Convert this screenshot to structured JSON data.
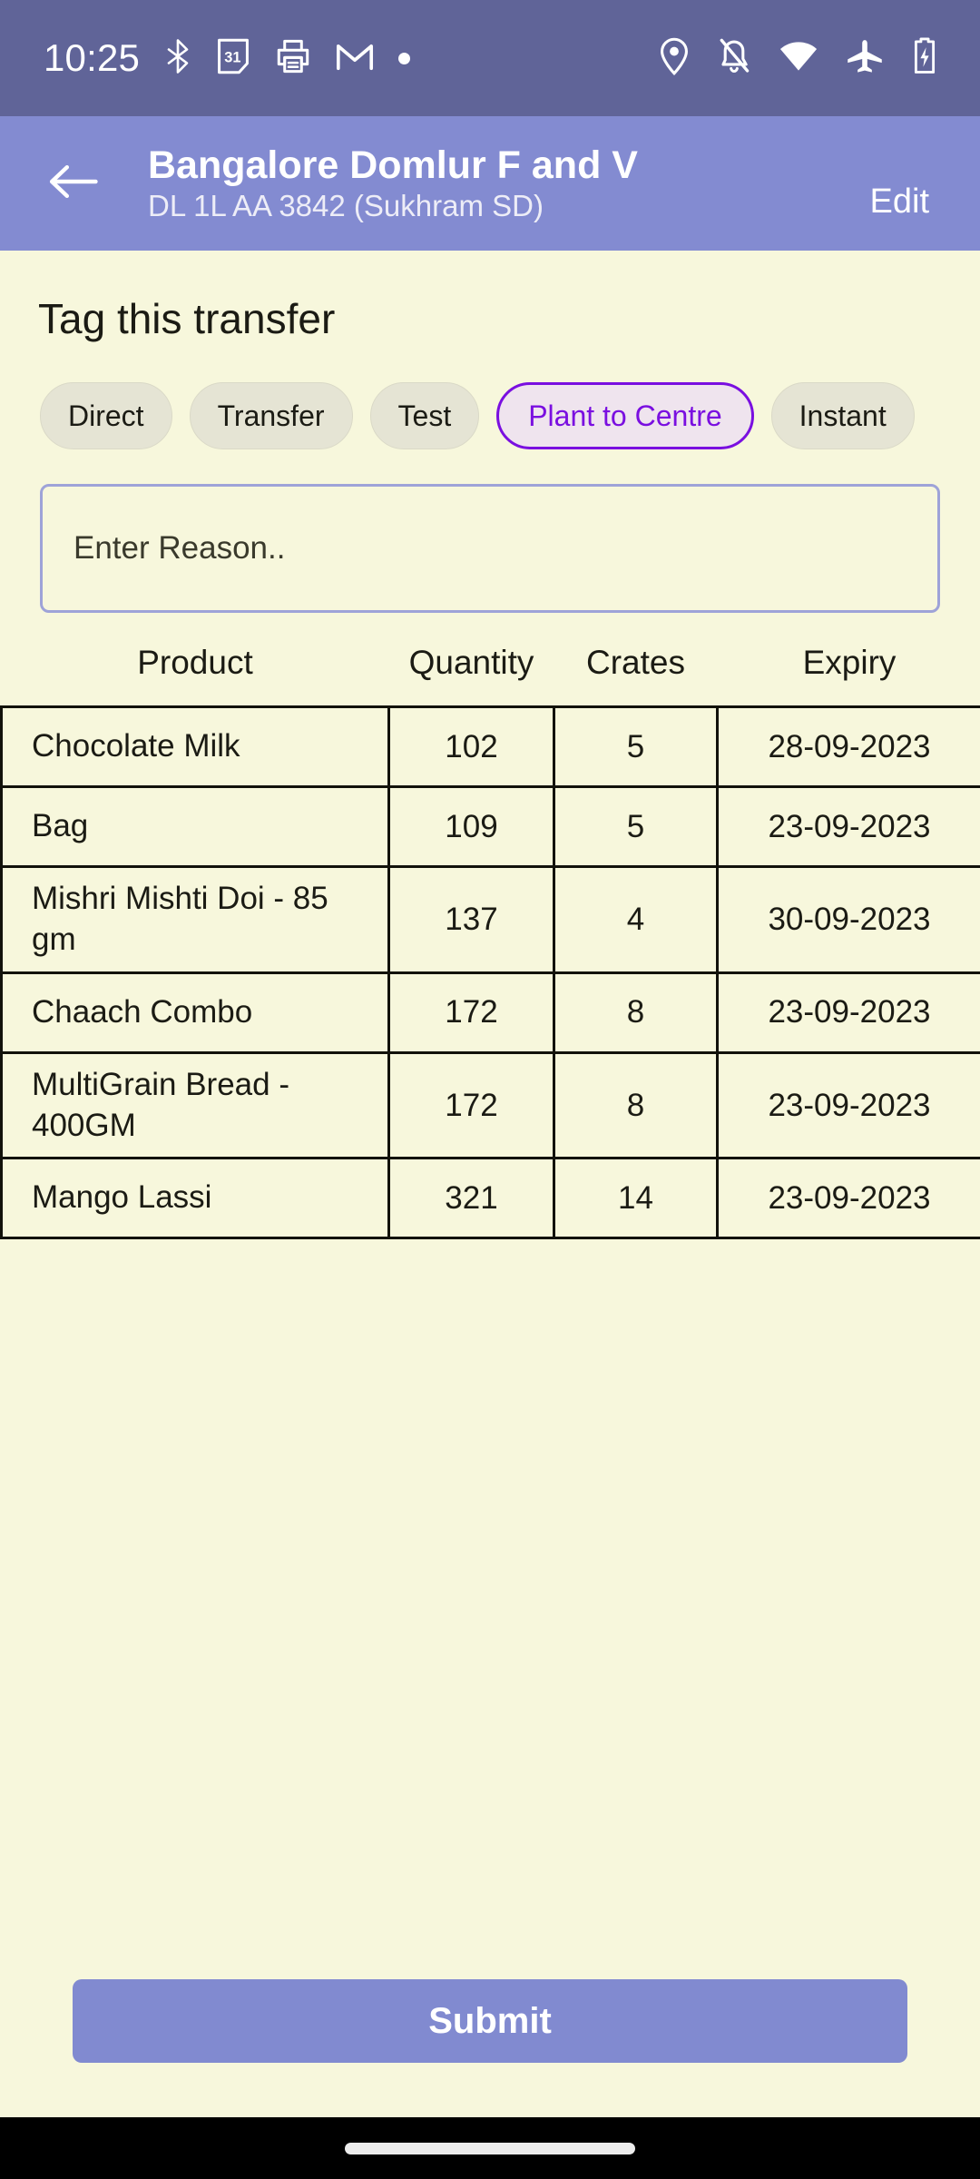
{
  "status_bar": {
    "time": "10:25",
    "left_icons": [
      "bluetooth-icon",
      "calendar-icon",
      "printer-icon",
      "gmail-icon",
      "dot-icon"
    ],
    "calendar_day": "31",
    "right_icons": [
      "location-icon",
      "notifications-off-icon",
      "wifi-icon",
      "airplane-mode-icon",
      "battery-charging-icon"
    ],
    "background": "#606498"
  },
  "app_bar": {
    "back_icon": "arrow-left-icon",
    "title": "Bangalore Domlur F and V",
    "subtitle": "DL 1L AA 3842 (Sukhram SD)",
    "edit_label": "Edit",
    "background": "#838BD1"
  },
  "main": {
    "section_title": "Tag this transfer",
    "chips": [
      {
        "label": "Direct",
        "selected": false
      },
      {
        "label": "Transfer",
        "selected": false
      },
      {
        "label": "Test",
        "selected": false
      },
      {
        "label": "Plant to Centre",
        "selected": true
      },
      {
        "label": "Instant",
        "selected": false
      }
    ],
    "reason_field": {
      "placeholder": "Enter Reason..",
      "value": ""
    },
    "table": {
      "columns": [
        "Product",
        "Quantity",
        "Crates",
        "Expiry"
      ],
      "rows": [
        {
          "product": "Chocolate Milk",
          "quantity": "102",
          "crates": "5",
          "expiry": "28-09-2023",
          "tall": false
        },
        {
          "product": "Bag",
          "quantity": "109",
          "crates": "5",
          "expiry": "23-09-2023",
          "tall": false
        },
        {
          "product": "Mishri Mishti Doi - 85 gm",
          "quantity": "137",
          "crates": "4",
          "expiry": "30-09-2023",
          "tall": true
        },
        {
          "product": "Chaach Combo",
          "quantity": "172",
          "crates": "8",
          "expiry": "23-09-2023",
          "tall": false
        },
        {
          "product": "MultiGrain Bread - 400GM",
          "quantity": "172",
          "crates": "8",
          "expiry": "23-09-2023",
          "tall": true
        },
        {
          "product": "Mango Lassi",
          "quantity": "321",
          "crates": "14",
          "expiry": "23-09-2023",
          "tall": false
        }
      ]
    },
    "submit_label": "Submit"
  },
  "theme": {
    "page_background": "#F7F7DC",
    "accent_purple": "#7A0FE0",
    "chip_background": "#E5E4D4",
    "chip_selected_background": "#EFE4EE",
    "submit_background": "#818AD0",
    "table_border": "#12120B",
    "input_border": "#9EA3D8"
  },
  "nav_bar": {
    "background": "#000000",
    "gesture_pill": "home-indicator"
  }
}
